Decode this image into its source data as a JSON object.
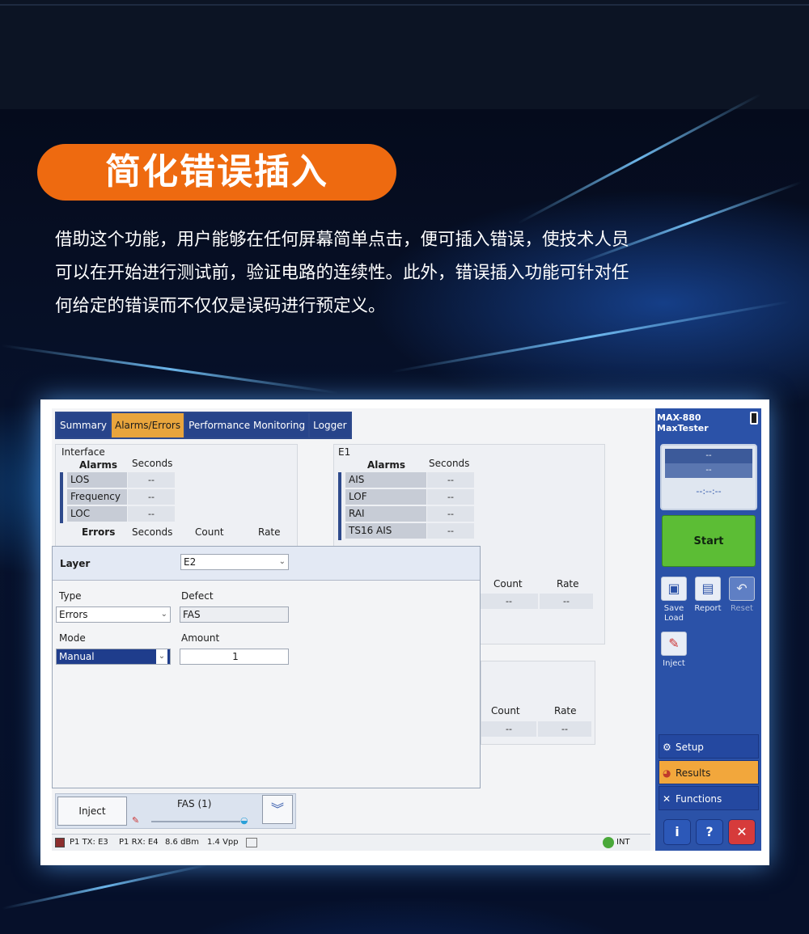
{
  "banner": {
    "title": "简化错误插入",
    "intro_lines": [
      "借助这个功能，用户能够在任何屏幕简单点击，便可插入错误，使技术人员",
      "可以在开始进行测试前，验证电路的连续性。此外，错误插入功能可针对任",
      "何给定的错误而不仅仅是误码进行预定义。"
    ]
  },
  "colors": {
    "accent_orange": "#ee6a10",
    "panel_blue": "#2b52a8",
    "start_green": "#5cbd35",
    "tab_active": "#e9a53c"
  },
  "tabs": [
    {
      "label": "Summary",
      "active": false
    },
    {
      "label": "Alarms/Errors",
      "active": true
    },
    {
      "label": "Performance Monitoring",
      "active": false
    },
    {
      "label": "Logger",
      "active": false
    }
  ],
  "interface_panel": {
    "title": "Interface",
    "alarms_header": "Alarms",
    "seconds_header": "Seconds",
    "alarms": [
      {
        "name": "LOS",
        "seconds": "--"
      },
      {
        "name": "Frequency",
        "seconds": "--"
      },
      {
        "name": "LOC",
        "seconds": "--"
      }
    ],
    "errors_header": "Errors",
    "errors_seconds_header": "Seconds",
    "count_header": "Count",
    "rate_header": "Rate"
  },
  "e1_panel": {
    "title": "E1",
    "alarms_header": "Alarms",
    "seconds_header": "Seconds",
    "alarms": [
      {
        "name": "AIS",
        "seconds": "--"
      },
      {
        "name": "LOF",
        "seconds": "--"
      },
      {
        "name": "RAI",
        "seconds": "--"
      },
      {
        "name": "TS16 AIS",
        "seconds": "--"
      }
    ],
    "count_header": "Count",
    "rate_header": "Rate",
    "count_value": "--",
    "rate_value": "--"
  },
  "lower_panel": {
    "count_header": "Count",
    "rate_header": "Rate",
    "count_value": "--",
    "rate_value": "--"
  },
  "dialog": {
    "layer_label": "Layer",
    "layer_value": "E2",
    "type_label": "Type",
    "type_value": "Errors",
    "defect_label": "Defect",
    "defect_value": "FAS",
    "mode_label": "Mode",
    "mode_value": "Manual",
    "amount_label": "Amount",
    "amount_value": "1"
  },
  "inject_bar": {
    "button_label": "Inject",
    "selection_label": "FAS (1)"
  },
  "status_bar": {
    "tx": "P1 TX: E3",
    "rx": "P1 RX: E4",
    "power": "8.6 dBm",
    "voltage": "1.4 Vpp",
    "clock": "INT"
  },
  "sidebar": {
    "device": "MAX-880",
    "model": "MaxTester",
    "clock_line1": "--",
    "clock_line2": "--",
    "clock_time": "--:--:--",
    "start_label": "Start",
    "tools": [
      {
        "label": "Save Load",
        "icon": "save-icon"
      },
      {
        "label": "Report",
        "icon": "report-icon"
      },
      {
        "label": "Reset",
        "icon": "reset-icon"
      },
      {
        "label": "Inject",
        "icon": "inject-icon"
      }
    ],
    "nav": [
      {
        "label": "Setup",
        "active": false,
        "icon": "gear-icon"
      },
      {
        "label": "Results",
        "active": true,
        "icon": "pie-chart-icon"
      },
      {
        "label": "Functions",
        "active": false,
        "icon": "tools-icon"
      }
    ],
    "bottom_buttons": [
      {
        "symbol": "i",
        "icon": "info-icon"
      },
      {
        "symbol": "?",
        "icon": "help-icon"
      },
      {
        "symbol": "✕",
        "icon": "close-icon"
      }
    ]
  }
}
